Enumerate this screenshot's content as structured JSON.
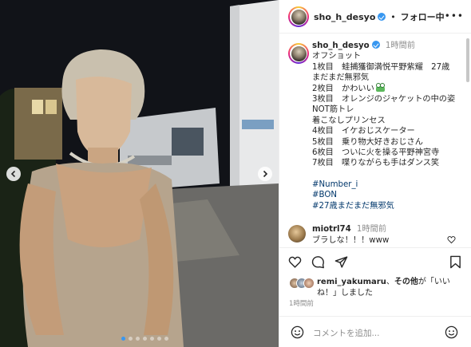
{
  "post": {
    "username": "sho_h_desyo",
    "separator": "•",
    "follow_label": "フォロー中",
    "more_label": "•••",
    "slide_count": 7,
    "active_slide": 1
  },
  "caption": {
    "username": "sho_h_desyo",
    "time": "1時間前",
    "lines": [
      "オフショット",
      "1枚目　蛙捕獲御満悦平野紫耀　27歳",
      "まだまだ無邪気",
      "2枚目　かわいい",
      "3枚目　オレンジのジャケットの中の姿",
      "NOT筋トレ",
      "着こなしプリンセス",
      "4枚目　イケおじスケーター",
      "5枚目　乗り物大好きおじさん",
      "6枚目　ついに火を操る平野神宮寺",
      "7枚目　喋りながらも手はダンス笑"
    ],
    "hashtags": [
      "#Number_i",
      "#BON",
      "#27歳まだまだ無邪気"
    ]
  },
  "comment": {
    "username": "miotrl74",
    "time": "1時間前",
    "text": "ブラしな！！！www"
  },
  "likes": {
    "liker": "remi_yakumaru",
    "text_pre": "、",
    "others": "その他",
    "text_post": "が「いいね！」しました"
  },
  "post_time": "1時間前",
  "comment_input": {
    "placeholder": "コメントを追加..."
  },
  "icons": {
    "verified": "verified-badge-icon",
    "more": "more-options-icon",
    "like": "heart-icon",
    "comment": "comment-bubble-icon",
    "share": "paper-plane-icon",
    "save": "bookmark-icon",
    "emoji": "smiley-icon",
    "prev": "chevron-left-icon",
    "next": "chevron-right-icon"
  },
  "colors": {
    "accent": "#3897f0",
    "link": "#00376b",
    "muted": "#8e8e8e"
  }
}
